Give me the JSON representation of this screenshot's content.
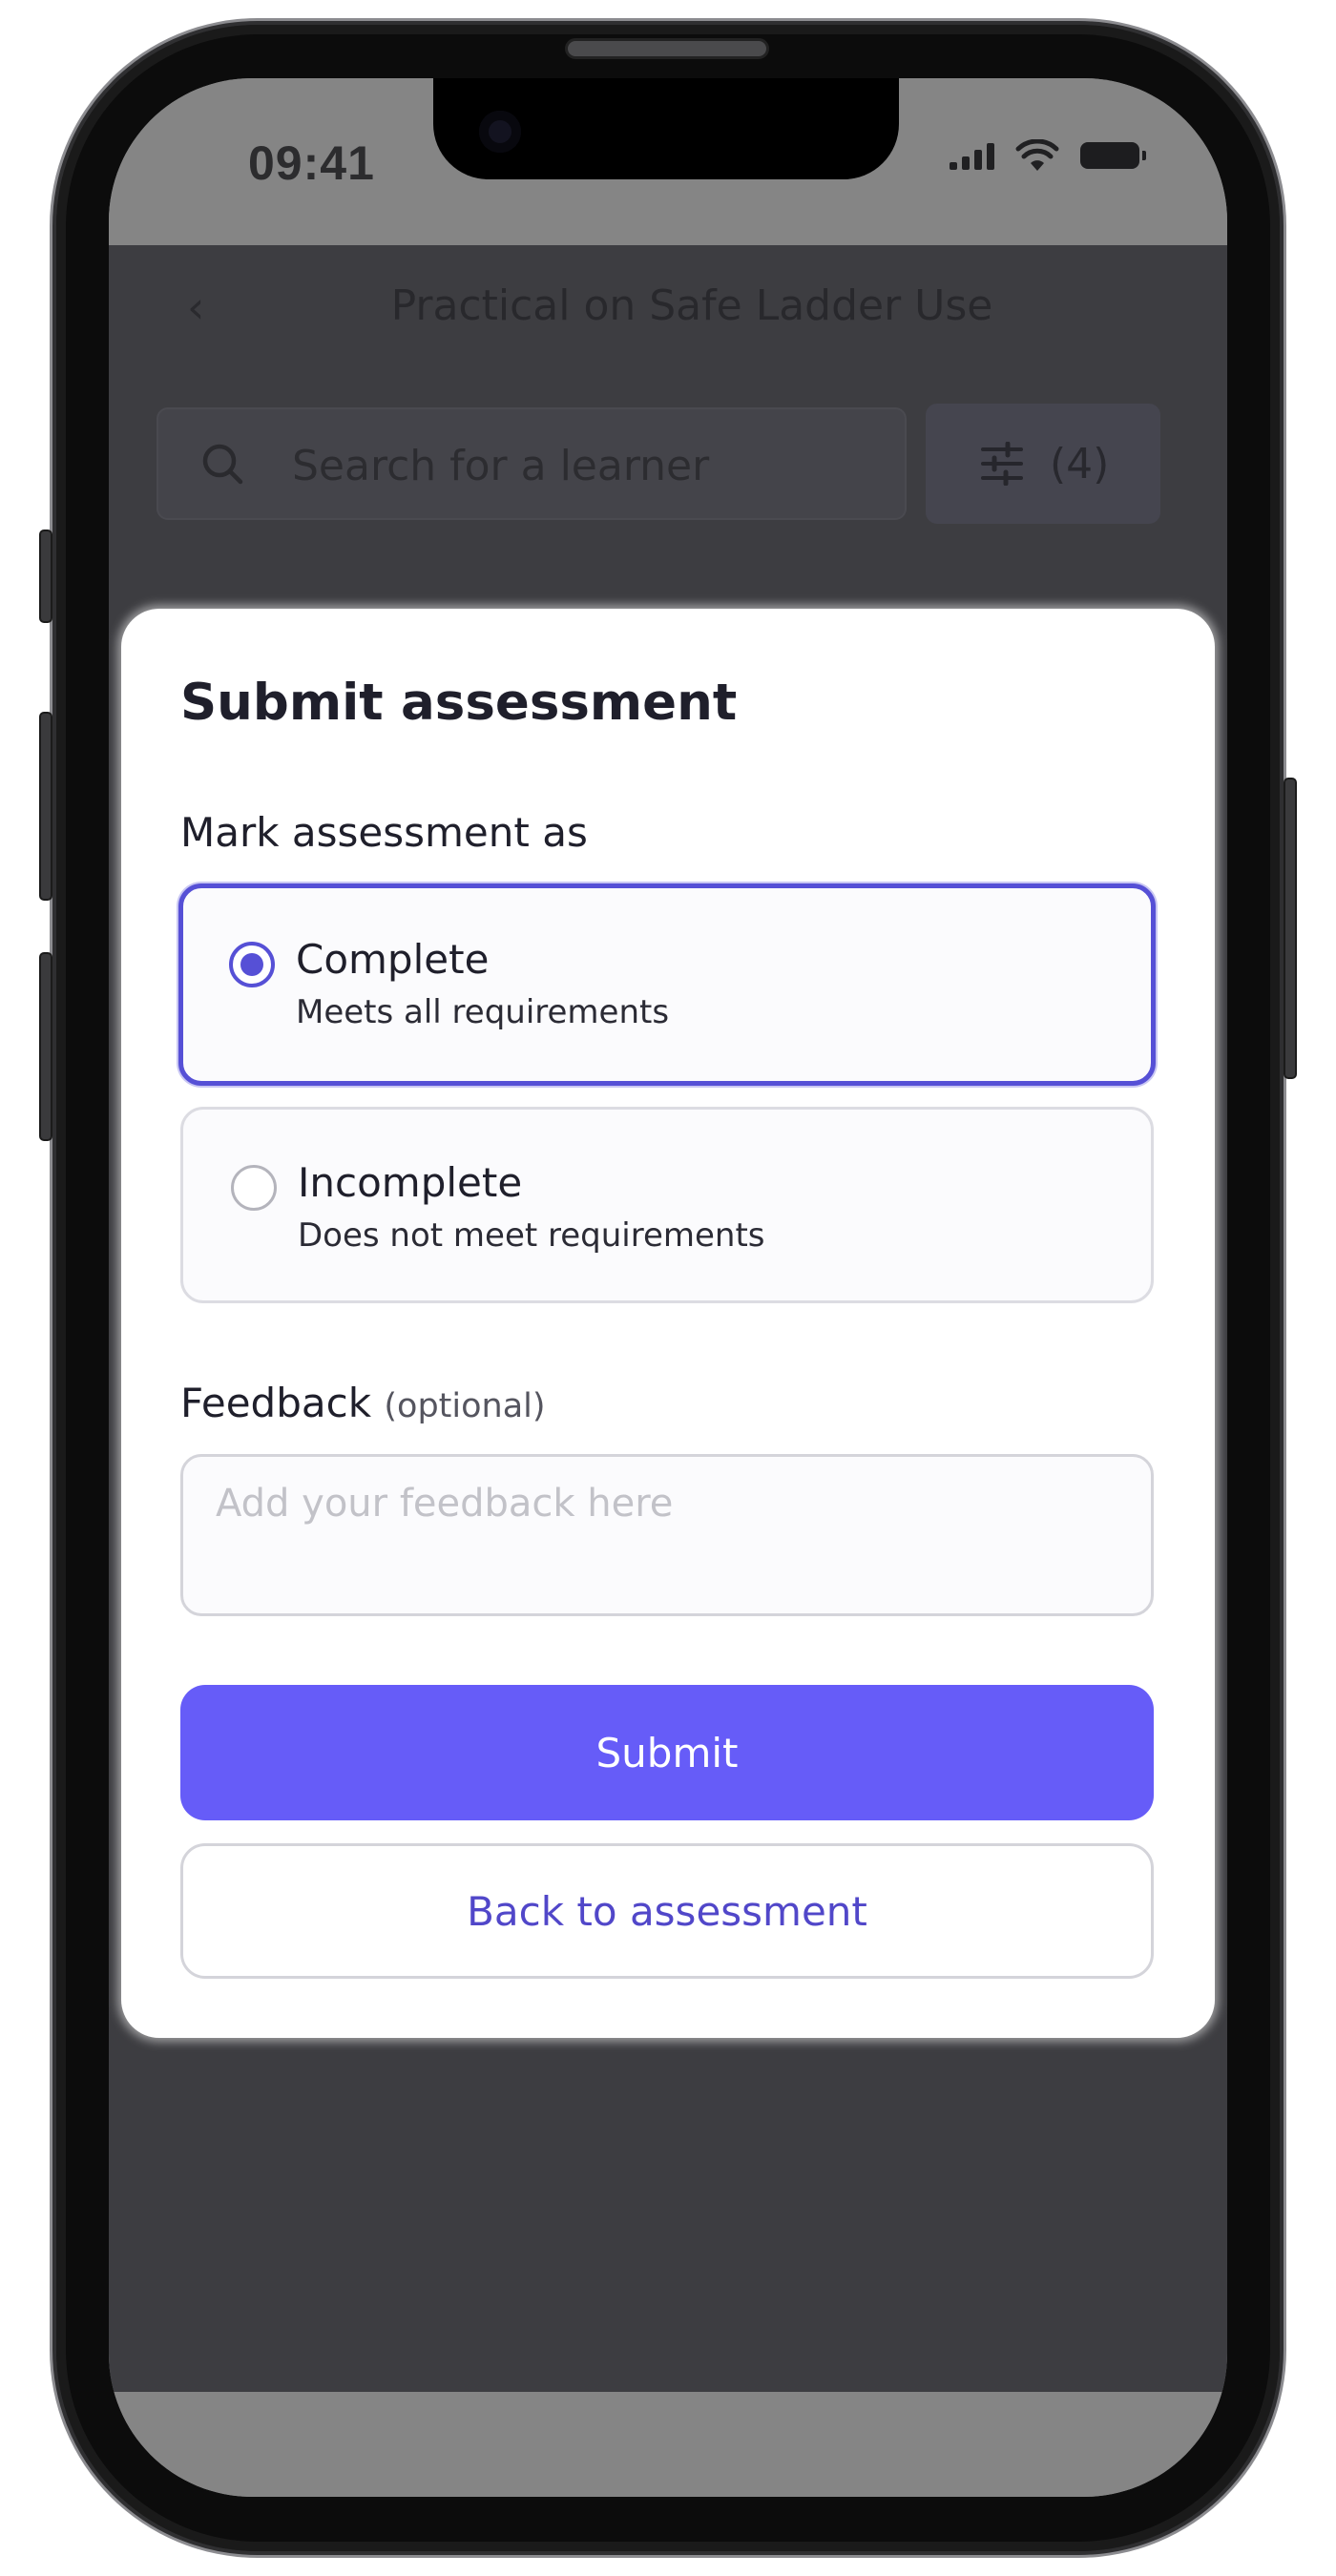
{
  "status_bar": {
    "time": "09:41"
  },
  "background_screen": {
    "back_icon": "chevron-left-icon",
    "title": "Practical on Safe Ladder Use",
    "search": {
      "placeholder": "Search for a learner",
      "icon": "search-icon"
    },
    "filter": {
      "icon": "sliders-icon",
      "count_label": "(4)"
    }
  },
  "modal": {
    "title": "Submit assessment",
    "mark_label": "Mark assessment as",
    "options": [
      {
        "title": "Complete",
        "description": "Meets all requirements",
        "selected": true
      },
      {
        "title": "Incomplete",
        "description": "Does not meet requirements",
        "selected": false
      }
    ],
    "feedback": {
      "label": "Feedback",
      "hint": "(optional)",
      "placeholder": "Add your feedback here",
      "value": ""
    },
    "submit_label": "Submit",
    "back_label": "Back to assessment"
  },
  "colors": {
    "accent": "#665cf8",
    "accent_dark": "#5650d6",
    "link": "#5147c9",
    "overlay": "#3d3d41"
  }
}
